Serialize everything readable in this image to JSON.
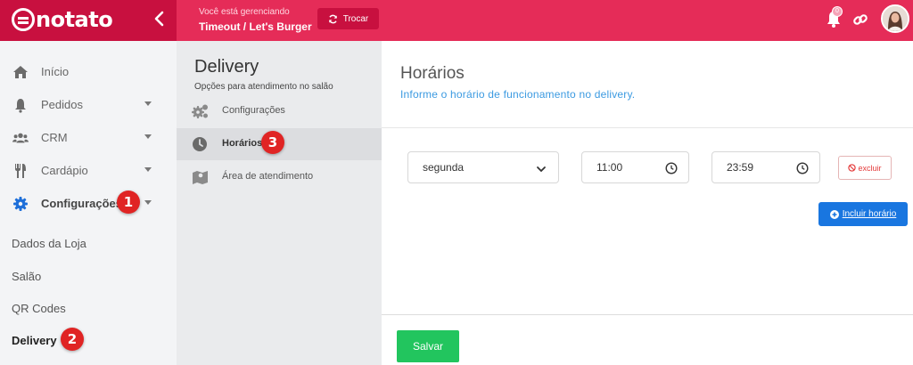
{
  "app": {
    "name": "notato"
  },
  "header": {
    "managing_label": "Você está gerenciando",
    "store_name": "Timeout / Let's Burger",
    "swap_label": "Trocar",
    "notification_count": "0"
  },
  "sidebar": {
    "items": [
      {
        "label": "Início",
        "icon": "home-icon"
      },
      {
        "label": "Pedidos",
        "icon": "bell-icon"
      },
      {
        "label": "CRM",
        "icon": "users-icon"
      },
      {
        "label": "Cardápio",
        "icon": "utensils-icon"
      },
      {
        "label": "Configurações",
        "icon": "gear-icon"
      }
    ],
    "subitems": [
      {
        "label": "Dados da Loja"
      },
      {
        "label": "Salão"
      },
      {
        "label": "QR Codes"
      },
      {
        "label": "Delivery"
      }
    ]
  },
  "middle": {
    "title": "Delivery",
    "subtitle": "Opções para atendimento no salão",
    "items": [
      {
        "label": "Configurações",
        "icon": "gears-icon"
      },
      {
        "label": "Horários",
        "icon": "clock-icon"
      },
      {
        "label": "Área de atendimento",
        "icon": "map-icon"
      }
    ]
  },
  "content": {
    "title": "Horários",
    "subtitle": "Informe o horário de funcionamento no delivery.",
    "day_value": "segunda",
    "start_time": "11:00",
    "end_time": "23:59",
    "delete_label": "excluir",
    "add_label": "Incluir horário",
    "save_label": "Salvar"
  },
  "markers": [
    "1",
    "2",
    "3"
  ],
  "colors": {
    "brand": "#e52c58",
    "brand_dark": "#c8103f",
    "primary": "#1976e0",
    "success": "#22c55e",
    "marker": "#e02424"
  }
}
